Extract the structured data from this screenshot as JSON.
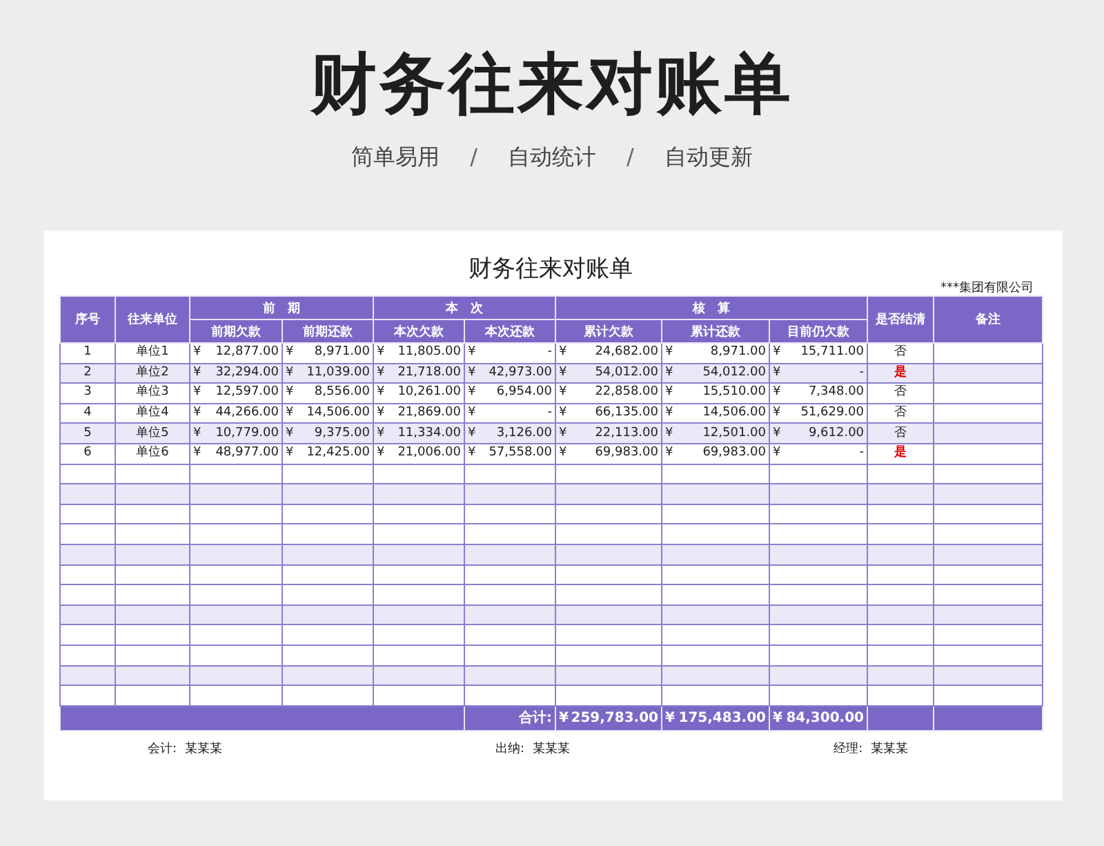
{
  "page_title": "财务往来对账单",
  "taglines": [
    "简单易用",
    "自动统计",
    "自动更新"
  ],
  "separator": "/",
  "sheet": {
    "title": "财务往来对账单",
    "company": "***集团有限公司",
    "header": {
      "no": "序号",
      "party": "往来单位",
      "groups": [
        {
          "label": "前　期",
          "columns": [
            "前期欠款",
            "前期还款"
          ]
        },
        {
          "label": "本　次",
          "columns": [
            "本次欠款",
            "本次还款"
          ]
        },
        {
          "label": "核　算",
          "columns": [
            "累计欠款",
            "累计还款",
            "目前仍欠款"
          ]
        }
      ],
      "settled": "是否结清",
      "note": "备注"
    },
    "currency": "¥",
    "rows": [
      {
        "no": "1",
        "party": "单位1",
        "amounts": [
          "12,877.00",
          "8,971.00",
          "11,805.00",
          "-",
          "24,682.00",
          "8,971.00",
          "15,711.00"
        ],
        "settled_text": "否",
        "settled": false
      },
      {
        "no": "2",
        "party": "单位2",
        "amounts": [
          "32,294.00",
          "11,039.00",
          "21,718.00",
          "42,973.00",
          "54,012.00",
          "54,012.00",
          "-"
        ],
        "settled_text": "是",
        "settled": true
      },
      {
        "no": "3",
        "party": "单位3",
        "amounts": [
          "12,597.00",
          "8,556.00",
          "10,261.00",
          "6,954.00",
          "22,858.00",
          "15,510.00",
          "7,348.00"
        ],
        "settled_text": "否",
        "settled": false
      },
      {
        "no": "4",
        "party": "单位4",
        "amounts": [
          "44,266.00",
          "14,506.00",
          "21,869.00",
          "-",
          "66,135.00",
          "14,506.00",
          "51,629.00"
        ],
        "settled_text": "否",
        "settled": false
      },
      {
        "no": "5",
        "party": "单位5",
        "amounts": [
          "10,779.00",
          "9,375.00",
          "11,334.00",
          "3,126.00",
          "22,113.00",
          "12,501.00",
          "9,612.00"
        ],
        "settled_text": "否",
        "settled": false
      },
      {
        "no": "6",
        "party": "单位6",
        "amounts": [
          "48,977.00",
          "12,425.00",
          "21,006.00",
          "57,558.00",
          "69,983.00",
          "69,983.00",
          "-"
        ],
        "settled_text": "是",
        "settled": true
      }
    ],
    "total": {
      "label": "合计:",
      "amounts": [
        "259,783.00",
        "175,483.00",
        "84,300.00"
      ]
    },
    "signatures": [
      {
        "role": "会计:",
        "name": "某某某"
      },
      {
        "role": "出纳:",
        "name": "某某某"
      },
      {
        "role": "经理:",
        "name": "某某某"
      }
    ]
  }
}
